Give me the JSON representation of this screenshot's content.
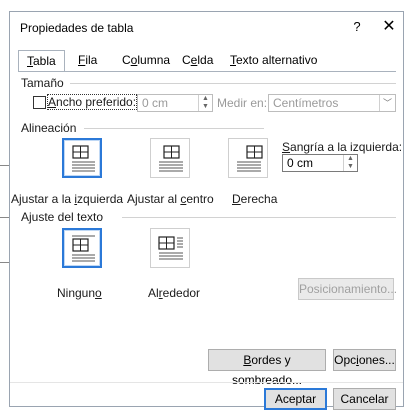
{
  "dialog": {
    "title": "Propiedades de tabla",
    "help_label": "?",
    "close_label": "✕"
  },
  "tabs": [
    {
      "label_pre": "",
      "label_key": "T",
      "label_post": "abla",
      "active": true
    },
    {
      "label_pre": "",
      "label_key": "F",
      "label_post": "ila",
      "active": false
    },
    {
      "label_pre": "C",
      "label_key": "o",
      "label_post": "lumna",
      "active": false
    },
    {
      "label_pre": "C",
      "label_key": "e",
      "label_post": "lda",
      "active": false
    },
    {
      "label_pre": "",
      "label_key": "T",
      "label_post": "exto alternativo",
      "active": false
    }
  ],
  "size": {
    "section_label": "Tamaño",
    "preferred_width_pre": "",
    "preferred_width_key": "A",
    "preferred_width_post": "ncho preferido:",
    "width_value": "0 cm",
    "measure_label": "Medir en:",
    "measure_value": "Centímetros"
  },
  "alignment": {
    "section_label": "Alineación",
    "left_pre": "Ajustar a la ",
    "left_key": "i",
    "left_post": "zquierda",
    "center_pre": "Ajustar al ",
    "center_key": "c",
    "center_post": "entro",
    "right_pre": "",
    "right_key": "D",
    "right_post": "erecha",
    "indent_pre": "",
    "indent_key": "S",
    "indent_post": "angría a la izquierda:",
    "indent_value": "0 cm"
  },
  "wrapping": {
    "section_label": "Ajuste del texto",
    "none_pre": "Ningun",
    "none_key": "o",
    "none_post": "",
    "around_pre": "Al",
    "around_key": "r",
    "around_post": "ededor",
    "positioning_label": "Posicionamiento..."
  },
  "buttons": {
    "borders_pre": "",
    "borders_key": "B",
    "borders_post": "ordes y sombreado...",
    "options_pre": "Opc",
    "options_key": "i",
    "options_post": "ones...",
    "accept": "Aceptar",
    "cancel": "Cancelar"
  },
  "colors": {
    "accent": "#2b79d8",
    "text": "#1a1a1a",
    "disabled_text": "#9a9a9a"
  }
}
